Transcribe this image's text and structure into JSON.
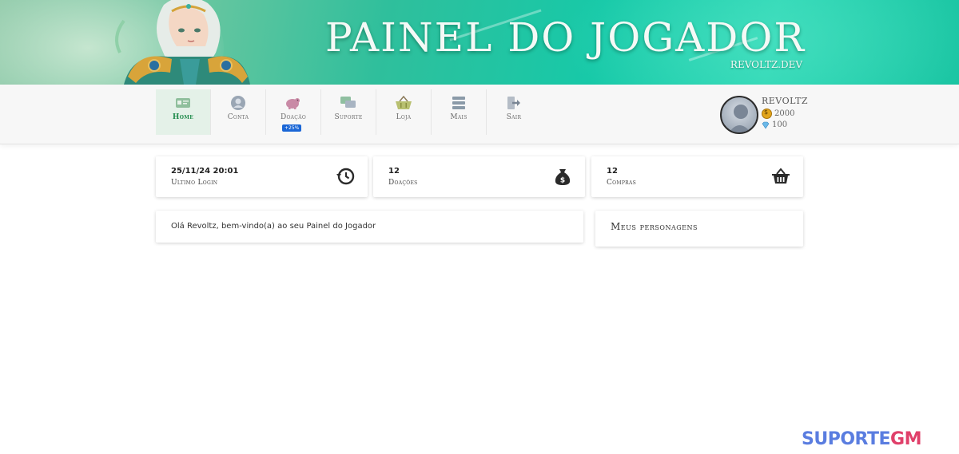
{
  "banner": {
    "title": "PAINEL DO JOGADOR",
    "subtitle": "REVOLTZ.DEV"
  },
  "nav": {
    "items": [
      {
        "label": "Home",
        "icon": "id-card-icon",
        "active": true
      },
      {
        "label": "Conta",
        "icon": "user-circle-icon",
        "active": false
      },
      {
        "label": "Doação",
        "icon": "piggy-bank-icon",
        "active": false,
        "badge": "+25%"
      },
      {
        "label": "Suporte",
        "icon": "chat-bubbles-icon",
        "active": false
      },
      {
        "label": "Loja",
        "icon": "basket-icon",
        "active": false
      },
      {
        "label": "Mais",
        "icon": "menu-icon",
        "active": false
      },
      {
        "label": "Sair",
        "icon": "logout-icon",
        "active": false
      }
    ]
  },
  "user": {
    "name": "REVOLTZ",
    "coins": "2000",
    "gems": "100"
  },
  "stats": [
    {
      "value": "25/11/24 20:01",
      "label": "Ultimo Login",
      "icon": "history-icon"
    },
    {
      "value": "12",
      "label": "Doações",
      "icon": "money-bag-icon"
    },
    {
      "value": "12",
      "label": "Compras",
      "icon": "basket-icon"
    }
  ],
  "welcome": {
    "text": "Olá Revoltz, bem-vindo(a) ao seu Painel do Jogador"
  },
  "characters": {
    "title": "Meus personagens"
  },
  "watermark": {
    "part1": "SUPORTE",
    "part2": "GM"
  },
  "colors": {
    "accent": "#1e8a4a",
    "badge": "#1a66d6"
  }
}
